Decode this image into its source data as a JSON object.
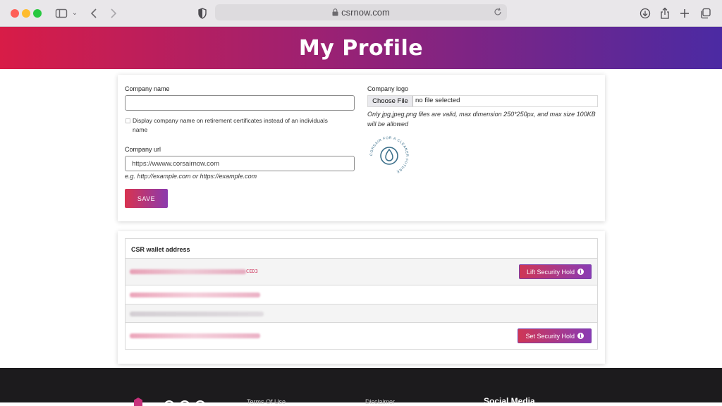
{
  "browser": {
    "url": "csrnow.com"
  },
  "header": {
    "title": "My Profile"
  },
  "profile_form": {
    "company_name": {
      "label": "Company name",
      "value": ""
    },
    "display_checkbox": {
      "label": "Display company name on retirement certificates instead of an individuals name",
      "checked": false
    },
    "company_url": {
      "label": "Company url",
      "value": "https://wwww.corsairnow.com",
      "hint": "e.g. http://example.com or https://example.com"
    },
    "save_label": "SAVE",
    "company_logo": {
      "label": "Company logo",
      "choose_label": "Choose File",
      "file_status": "no file selected",
      "hint": "Only jpg,jpeg,png files are valid, max dimension 250*250px, and max size 100KB will be allowed",
      "logo_text": "CORSAIR FOR A CLEANER FUTURE"
    }
  },
  "wallet": {
    "header": "CSR wallet address",
    "rows": [
      {
        "address_suffix": "CED3",
        "button": "Lift Security Hold"
      },
      {
        "address_suffix": "",
        "button": ""
      },
      {
        "address_suffix": "",
        "button": ""
      },
      {
        "address_suffix": "",
        "button": "Set Security Hold"
      }
    ]
  },
  "footer": {
    "links": [
      "Terms Of Use",
      "Disclaimer"
    ],
    "social_heading": "Social Media"
  },
  "colors": {
    "brand_red": "#d81c47",
    "brand_purple": "#4b2aa3",
    "accent_pink": "#d03a62"
  }
}
